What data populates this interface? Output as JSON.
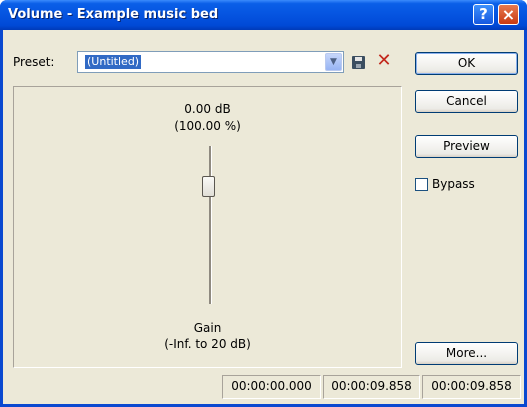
{
  "window": {
    "title": "Volume - Example music bed",
    "help_label": "?",
    "close_label": "×"
  },
  "preset": {
    "label": "Preset:",
    "value": "(Untitled)",
    "dropdown_glyph": "▼",
    "delete_glyph": "✕"
  },
  "buttons": {
    "ok": "OK",
    "cancel": "Cancel",
    "preview": "Preview",
    "more": "More..."
  },
  "bypass": {
    "label": "Bypass",
    "checked": false
  },
  "gain": {
    "readout_db": "0.00 dB",
    "readout_percent": "(100.00 %)",
    "label": "Gain",
    "range": "(-Inf. to 20 dB)"
  },
  "status_bar": {
    "start": "00:00:00.000",
    "end": "00:00:09.858",
    "length": "00:00:09.858"
  },
  "colors": {
    "titlebar": "#0554e0",
    "dialog_bg": "#ece9d8",
    "selection": "#316ac5",
    "delete_icon": "#c2281c"
  }
}
